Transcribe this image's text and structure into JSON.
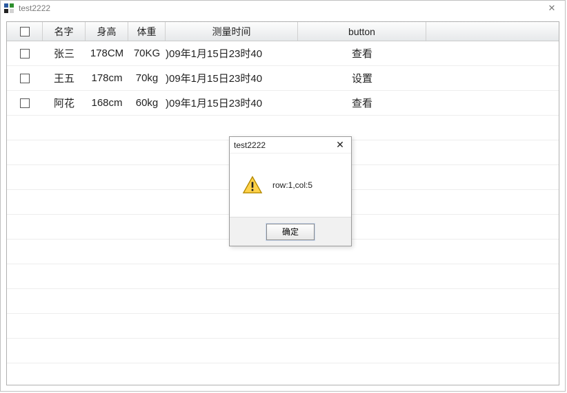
{
  "window": {
    "title": "test2222"
  },
  "table": {
    "headers": {
      "check": "",
      "name": "名字",
      "height": "身高",
      "weight": "体重",
      "time": "测量时间",
      "button": "button"
    },
    "rows": [
      {
        "name": "张三",
        "height": "178CM",
        "weight": "70KG",
        "time": ")09年1月15日23时40",
        "button": "查看"
      },
      {
        "name": "王五",
        "height": "178cm",
        "weight": "70kg",
        "time": ")09年1月15日23时40",
        "button": "设置"
      },
      {
        "name": "阿花",
        "height": "168cm",
        "weight": "60kg",
        "time": ")09年1月15日23时40",
        "button": "查看"
      }
    ]
  },
  "dialog": {
    "title": "test2222",
    "message": "row:1,col:5",
    "ok": "确定"
  }
}
